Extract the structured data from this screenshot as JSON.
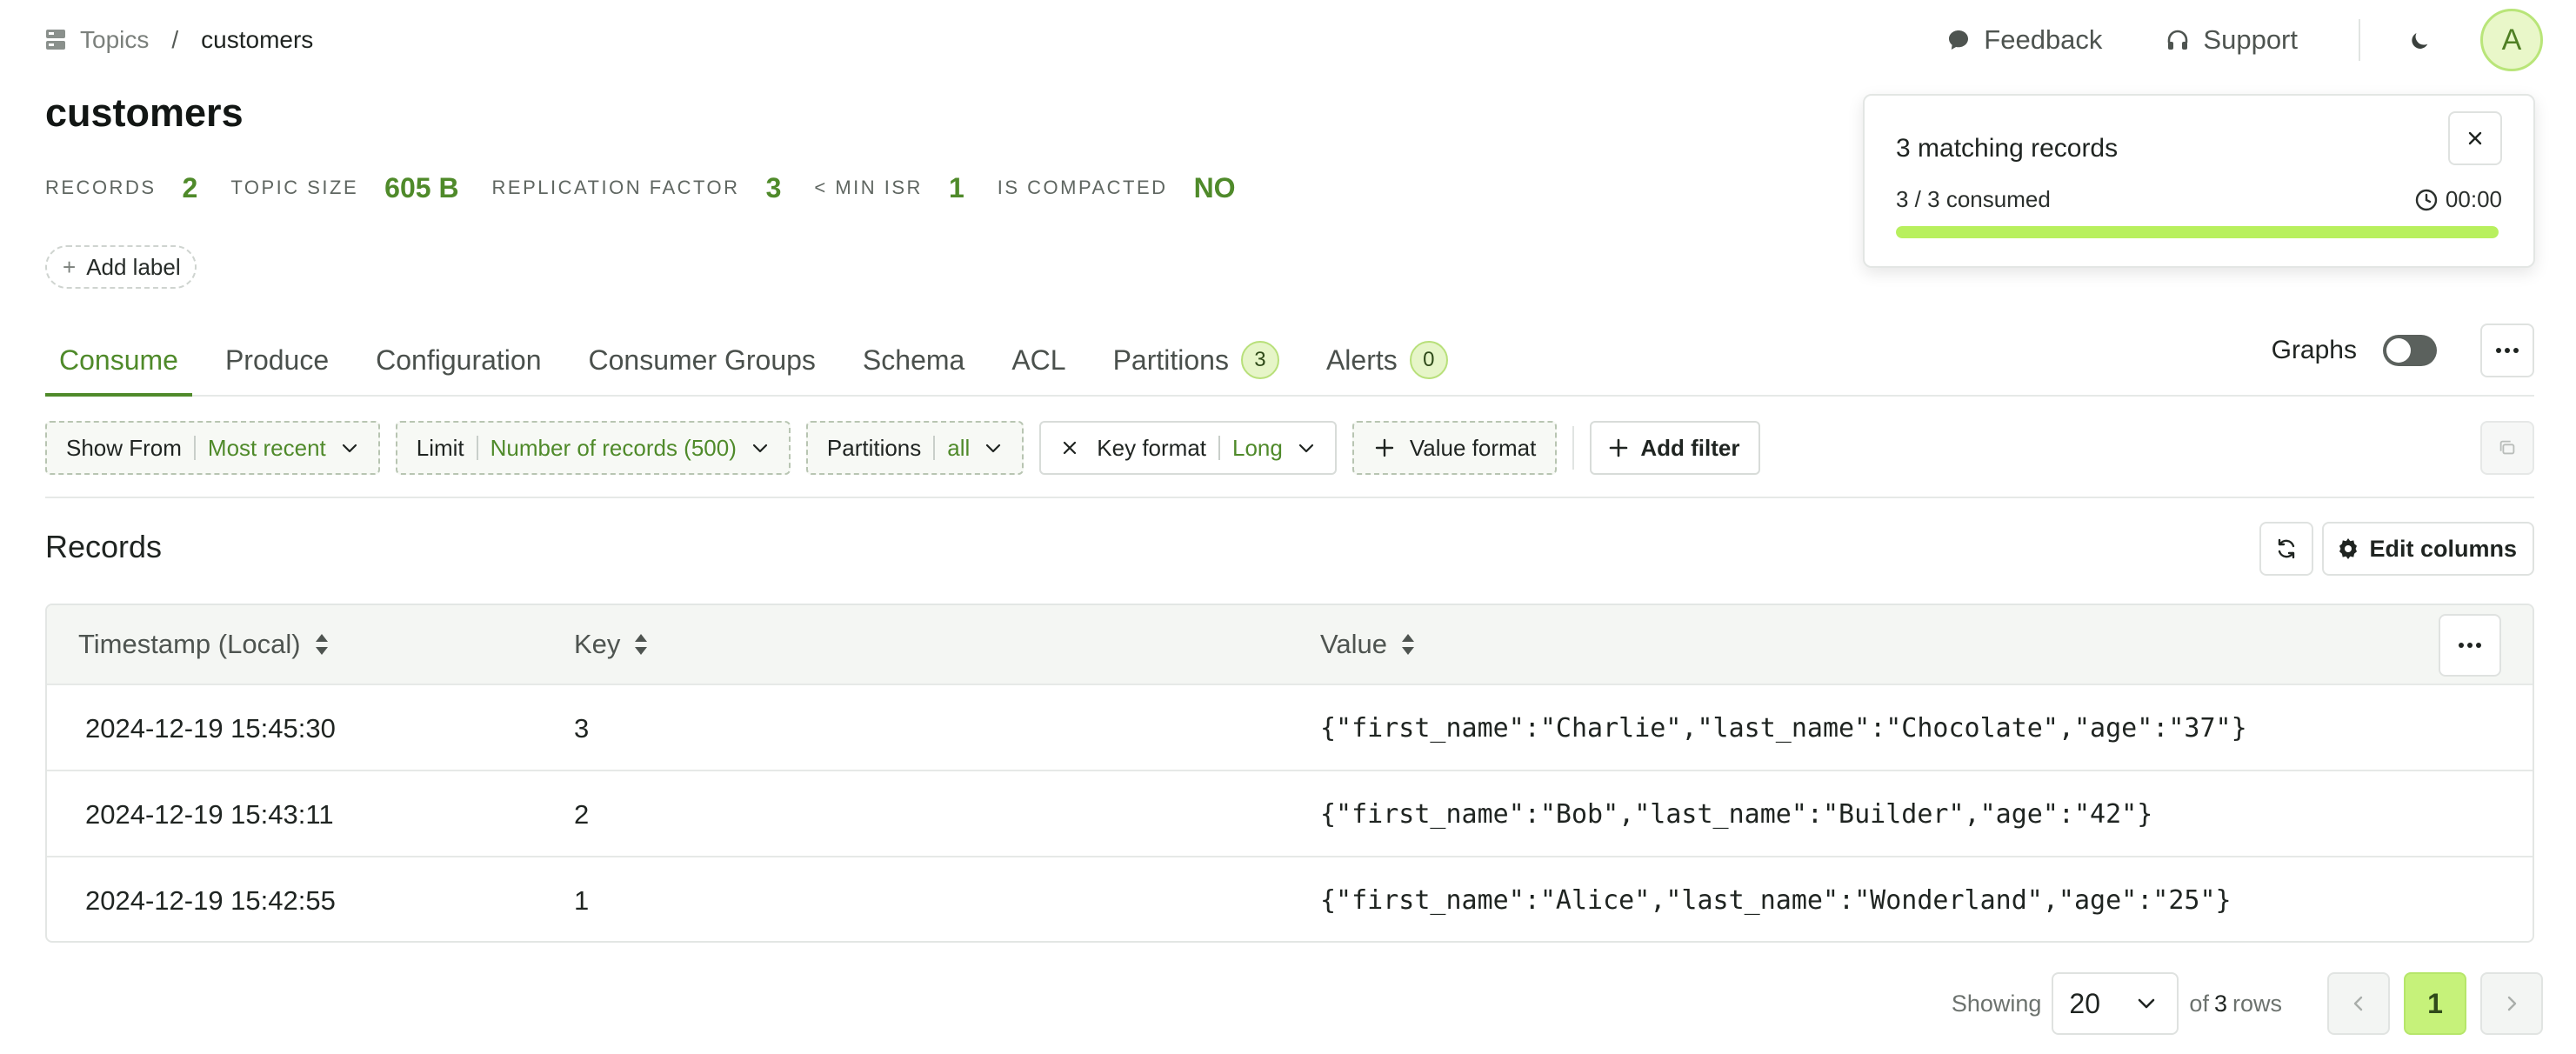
{
  "breadcrumb": {
    "root": "Topics",
    "separator": "/",
    "current": "customers"
  },
  "topnav": {
    "feedback": "Feedback",
    "support": "Support",
    "avatar": "A"
  },
  "page": {
    "title": "customers"
  },
  "stats": [
    {
      "label": "Records",
      "value": "2"
    },
    {
      "label": "Topic size",
      "value": "605 B"
    },
    {
      "label": "Replication factor",
      "value": "3"
    },
    {
      "label": "< Min ISR",
      "value": "1"
    },
    {
      "label": "Is compacted",
      "value": "NO"
    }
  ],
  "add_label": "Add label",
  "toast": {
    "title": "3 matching records",
    "consumed": "3 / 3 consumed",
    "time": "00:00",
    "progress": 1.0,
    "progress_color": "#b8f05e"
  },
  "tabs": [
    {
      "label": "Consume",
      "active": true
    },
    {
      "label": "Produce"
    },
    {
      "label": "Configuration"
    },
    {
      "label": "Consumer Groups"
    },
    {
      "label": "Schema"
    },
    {
      "label": "ACL"
    },
    {
      "label": "Partitions",
      "badge": "3"
    },
    {
      "label": "Alerts",
      "badge": "0"
    }
  ],
  "graphs": {
    "label": "Graphs",
    "enabled": false
  },
  "filters": {
    "show_from": {
      "label": "Show From",
      "value": "Most recent"
    },
    "limit": {
      "label": "Limit",
      "value": "Number of records (500)"
    },
    "partitions": {
      "label": "Partitions",
      "value": "all"
    },
    "key_format": {
      "label": "Key format",
      "value": "Long"
    },
    "value_format": {
      "label": "Value format"
    },
    "add_filter": "Add filter"
  },
  "records": {
    "title": "Records",
    "edit_columns": "Edit columns",
    "columns": [
      "Timestamp (Local)",
      "Key",
      "Value"
    ],
    "rows": [
      {
        "timestamp": "2024-12-19 15:45:30",
        "key": "3",
        "value": "{\"first_name\":\"Charlie\",\"last_name\":\"Chocolate\",\"age\":\"37\"}"
      },
      {
        "timestamp": "2024-12-19 15:43:11",
        "key": "2",
        "value": "{\"first_name\":\"Bob\",\"last_name\":\"Builder\",\"age\":\"42\"}"
      },
      {
        "timestamp": "2024-12-19 15:42:55",
        "key": "1",
        "value": "{\"first_name\":\"Alice\",\"last_name\":\"Wonderland\",\"age\":\"25\"}"
      }
    ]
  },
  "pagination": {
    "showing_label": "Showing",
    "page_size": "20",
    "of_label": "of",
    "total": "3",
    "rows_label": "rows",
    "current_page": "1"
  },
  "colors": {
    "accent": "#4f8a2a",
    "highlight": "#c6f27a"
  }
}
